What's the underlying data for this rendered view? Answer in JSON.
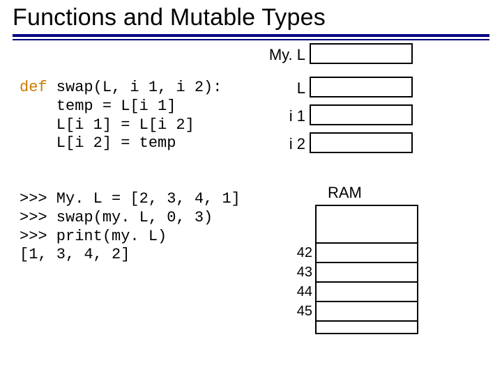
{
  "title": "Functions and Mutable Types",
  "labels": {
    "myl": "My. L",
    "L": "L",
    "i1": "i 1",
    "i2": "i 2",
    "ram": "RAM"
  },
  "code": {
    "kw_def": "def",
    "sig": " swap(L, i 1, i 2):",
    "l2": "    temp = L[i 1]",
    "l3": "    L[i 1] = L[i 2]",
    "l4": "    L[i 2] = temp"
  },
  "repl": {
    "l1": ">>> My. L = [2, 3, 4, 1]",
    "l2": ">>> swap(my. L, 0, 3)",
    "l3": ">>> print(my. L)",
    "l4": "[1, 3, 4, 2]"
  },
  "ram_indices": {
    "a": "42",
    "b": "43",
    "c": "44",
    "d": "45"
  }
}
